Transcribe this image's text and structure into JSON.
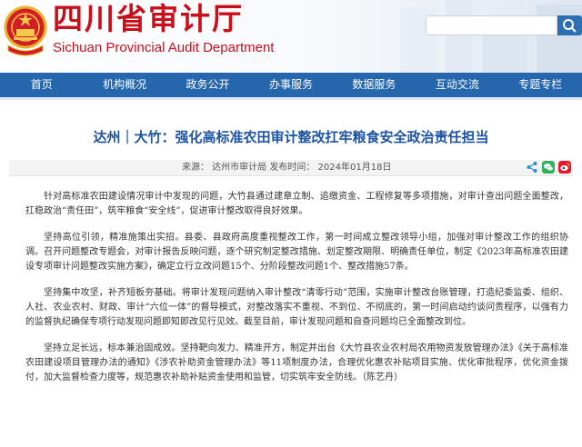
{
  "header": {
    "title_cn": "四川省审计厅",
    "title_en": "Sichuan Provincial Audit Department",
    "search_placeholder": ""
  },
  "nav": {
    "items": [
      {
        "label": "首页"
      },
      {
        "label": "机构概况"
      },
      {
        "label": "政务公开"
      },
      {
        "label": "办事服务"
      },
      {
        "label": "数据服务"
      },
      {
        "label": "互动交流"
      },
      {
        "label": "专题专栏"
      }
    ]
  },
  "article": {
    "title": "达州｜大竹：强化高标准农田审计整改扛牢粮食安全政治责任担当",
    "meta": "来源：    达州市审计局        发布时间：    2024年01月18日",
    "paragraphs": [
      "针对高标准农田建设情况审计中发现的问题，大竹县通过建章立制、追缴资金、工程修复等多项措施，对审计查出问题全面整改，扛稳政治“责任田”，筑牢粮食“安全线”，促进审计整改取得良好效果。",
      "坚持高位引领，精准施策出实招。县委、县政府高度重视整改工作，第一时间成立整改领导小组，加强对审计整改工作的组织协调。召开问题整改专题会，对审计报告反映问题，逐个研究制定整改措施、划定整改期限、明确责任单位，制定《2023年高标准农田建设专项审计问题整改实施方案》，确定立行立改问题15个、分阶段整改问题1个、整改措施57条。",
      "坚持集中攻坚，补齐短板夯基础。将审计发现问题纳入审计整改“清零行动”范围，实施审计整改台账管理，打造纪委监委、组织、人社、农业农村、财政、审计“六位一体”的督导模式，对整改落实不重视、不到位、不彻底的，第一时间启动约谈问责程序，以强有力的监督执纪确保专项行动发现问题即知即改见行见效。截至目前，审计发现问题和自查问题均已全面整改到位。",
      "坚持立足长远，标本兼治固成效。坚持靶向发力、精准开方，制定并出台《大竹县农业农村局农用物资发放管理办法》《关于高标准农田建设项目管理办法的通知》《涉农补助资金管理办法》等11项制度办法，合理优化惠农补贴项目实施、优化审批程序，优化资金拨付，加大监督检查力度等，规范惠农补助补贴资金使用和监管，切实筑牢安全防线。（陈艺丹）"
    ]
  },
  "colors": {
    "brand_red": "#c8101b",
    "nav_blue": "#2566ad",
    "title_blue": "#1d54a3"
  },
  "icons": [
    "national-emblem-icon",
    "search-icon",
    "share-icon",
    "wechat-icon",
    "weibo-icon"
  ]
}
